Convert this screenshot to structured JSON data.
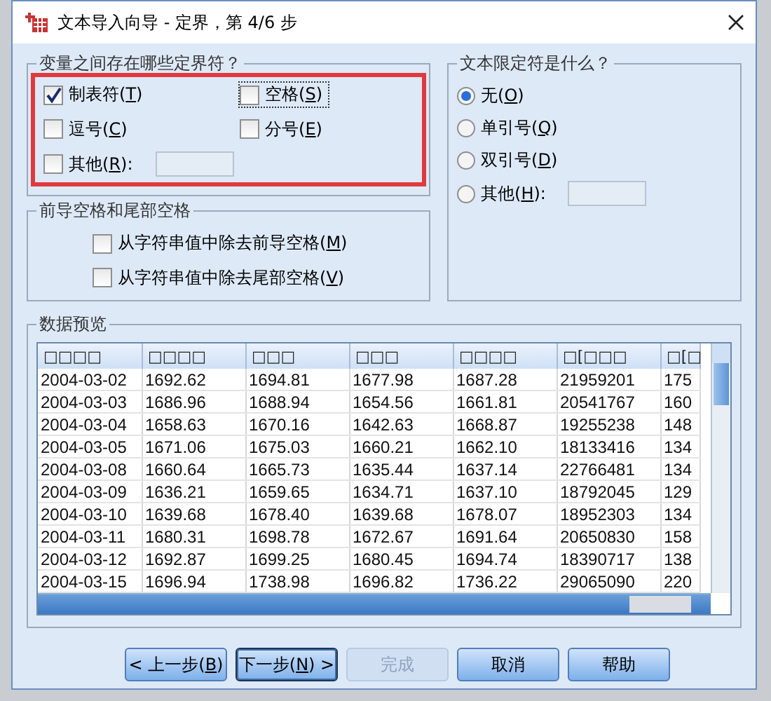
{
  "window": {
    "title": "文本导入向导 - 定界，第 4/6 步"
  },
  "delimiters": {
    "title": "变量之间存在哪些定界符？",
    "highlighted": true,
    "options": [
      {
        "label": "制表符(T)",
        "checked": true,
        "focused": false
      },
      {
        "label": "空格(S)",
        "checked": false,
        "focused": true
      },
      {
        "label": "逗号(C)",
        "checked": false,
        "focused": false
      },
      {
        "label": "分号(E)",
        "checked": false,
        "focused": false
      },
      {
        "label": "其他(R):",
        "checked": false,
        "focused": false,
        "kind": "field"
      }
    ]
  },
  "spaces": {
    "title": "前导空格和尾部空格",
    "options": [
      {
        "label": "从字符串值中除去前导空格(M)",
        "checked": false
      },
      {
        "label": "从字符串值中除去尾部空格(V)",
        "checked": false
      }
    ]
  },
  "qualifier": {
    "title": "文本限定符是什么？",
    "options": [
      {
        "label": "无(O)",
        "selected": true
      },
      {
        "label": "单引号(Q)",
        "selected": false
      },
      {
        "label": "双引号(D)",
        "selected": false
      },
      {
        "label": "其他(H):",
        "selected": false,
        "kind": "field"
      }
    ]
  },
  "preview": {
    "title": "数据预览",
    "columns": [
      "□□□□",
      "□□□□",
      "□□□",
      "□□□",
      "□□□□",
      "□[□□□",
      "□[□"
    ],
    "rows": [
      [
        "2004-03-02",
        "1692.62",
        "1694.81",
        "1677.98",
        "1687.28",
        "21959201",
        "175"
      ],
      [
        "2004-03-03",
        "1686.96",
        "1688.94",
        "1654.56",
        "1661.81",
        "20541767",
        "160"
      ],
      [
        "2004-03-04",
        "1658.63",
        "1670.16",
        "1642.63",
        "1668.87",
        "19255238",
        "148"
      ],
      [
        "2004-03-05",
        "1671.06",
        "1675.03",
        "1660.21",
        "1662.10",
        "18133416",
        "134"
      ],
      [
        "2004-03-08",
        "1660.64",
        "1665.73",
        "1635.44",
        "1637.14",
        "22766481",
        "134"
      ],
      [
        "2004-03-09",
        "1636.21",
        "1659.65",
        "1634.71",
        "1637.10",
        "18792045",
        "129"
      ],
      [
        "2004-03-10",
        "1639.68",
        "1678.40",
        "1639.68",
        "1678.07",
        "18952303",
        "134"
      ],
      [
        "2004-03-11",
        "1680.31",
        "1698.78",
        "1672.67",
        "1691.64",
        "20650830",
        "158"
      ],
      [
        "2004-03-12",
        "1692.87",
        "1699.25",
        "1680.45",
        "1694.74",
        "18390717",
        "138"
      ],
      [
        "2004-03-15",
        "1696.94",
        "1738.98",
        "1696.82",
        "1736.22",
        "29065090",
        "220"
      ]
    ]
  },
  "buttons": [
    {
      "label": "< 上一步(B)",
      "disabled": false,
      "default": false
    },
    {
      "label": "下一步(N) >",
      "disabled": false,
      "default": true
    },
    {
      "label": "完成",
      "disabled": true,
      "default": false
    },
    {
      "label": "取消",
      "disabled": false,
      "default": false
    },
    {
      "label": "帮助",
      "disabled": false,
      "default": false
    }
  ]
}
